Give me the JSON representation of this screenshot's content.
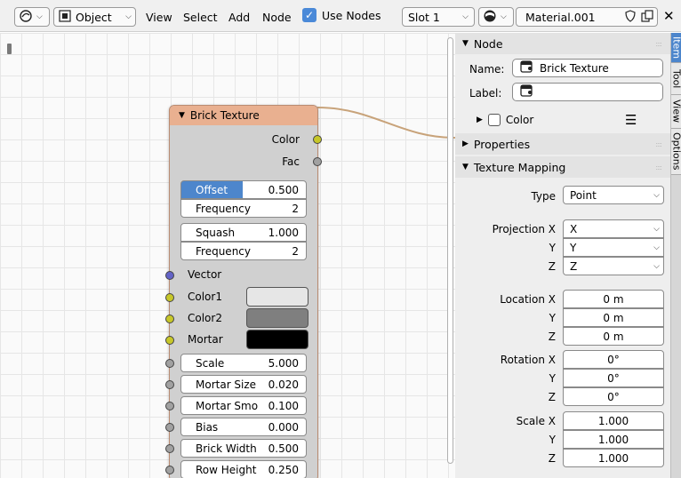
{
  "header": {
    "mode_select": "Object",
    "menu": [
      "View",
      "Select",
      "Add",
      "Node"
    ],
    "use_nodes_label": "Use Nodes",
    "use_nodes_checked": true,
    "slot_select": "Slot 1",
    "material_name": "Material.001",
    "close_glyph": "✕"
  },
  "node": {
    "title": "Brick Texture",
    "outputs": [
      "Color",
      "Fac"
    ],
    "offset": {
      "label": "Offset",
      "value": "0.500"
    },
    "frequency1": {
      "label": "Frequency",
      "value": "2"
    },
    "squash": {
      "label": "Squash",
      "value": "1.000"
    },
    "frequency2": {
      "label": "Frequency",
      "value": "2"
    },
    "vector_label": "Vector",
    "color1_label": "Color1",
    "color2_label": "Color2",
    "mortar_label": "Mortar",
    "color1": "#e6e6e6",
    "color2": "#7f7f7f",
    "mortar_color": "#000000",
    "inputs": [
      {
        "label": "Scale",
        "value": "5.000"
      },
      {
        "label": "Mortar Size",
        "value": "0.020"
      },
      {
        "label": "Mortar Smo",
        "value": "0.100"
      },
      {
        "label": "Bias",
        "value": "0.000"
      },
      {
        "label": "Brick Width",
        "value": "0.500"
      },
      {
        "label": "Row Height",
        "value": "0.250"
      }
    ]
  },
  "sidebar": {
    "node_panel": "Node",
    "name_label": "Name:",
    "name_value": "Brick Texture",
    "label_label": "Label:",
    "label_value": "",
    "color_label": "Color",
    "properties_panel": "Properties",
    "texture_mapping_panel": "Texture Mapping",
    "type_label": "Type",
    "type_value": "Point",
    "projection_labels": [
      "Projection X",
      "Y",
      "Z"
    ],
    "projection_values": [
      "X",
      "Y",
      "Z"
    ],
    "location_labels": [
      "Location X",
      "Y",
      "Z"
    ],
    "location_values": [
      "0 m",
      "0 m",
      "0 m"
    ],
    "rotation_labels": [
      "Rotation X",
      "Y",
      "Z"
    ],
    "rotation_values": [
      "0°",
      "0°",
      "0°"
    ],
    "scale_labels": [
      "Scale X",
      "Y",
      "Z"
    ],
    "scale_values": [
      "1.000",
      "1.000",
      "1.000"
    ]
  },
  "tabs": [
    "Item",
    "Tool",
    "View",
    "Options"
  ],
  "colors": {
    "accent": "#4d86cc",
    "node_header": "#e9b090",
    "link": "#c8a37a",
    "socket_yellow": "#c7c729",
    "socket_blue": "#6363c7",
    "socket_grey": "#a1a1a1"
  }
}
